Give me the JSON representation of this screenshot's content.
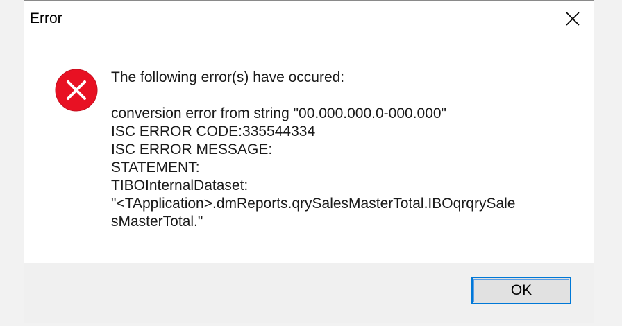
{
  "window": {
    "title": "Error",
    "close_icon": "close-icon"
  },
  "message": {
    "icon": "error-x-icon",
    "heading": "The following error(s) have occured:",
    "lines": [
      "conversion error from string \"00.000.000.0-000.000\"",
      "ISC ERROR CODE:335544334",
      "ISC ERROR MESSAGE:",
      "STATEMENT:",
      "TIBOInternalDataset:",
      "\"<TApplication>.dmReports.qrySalesMasterTotal.IBOqrqrySale",
      "sMasterTotal.\""
    ]
  },
  "buttons": {
    "ok_label": "OK"
  },
  "colors": {
    "error_red": "#e81123",
    "button_accent": "#0078d7"
  }
}
